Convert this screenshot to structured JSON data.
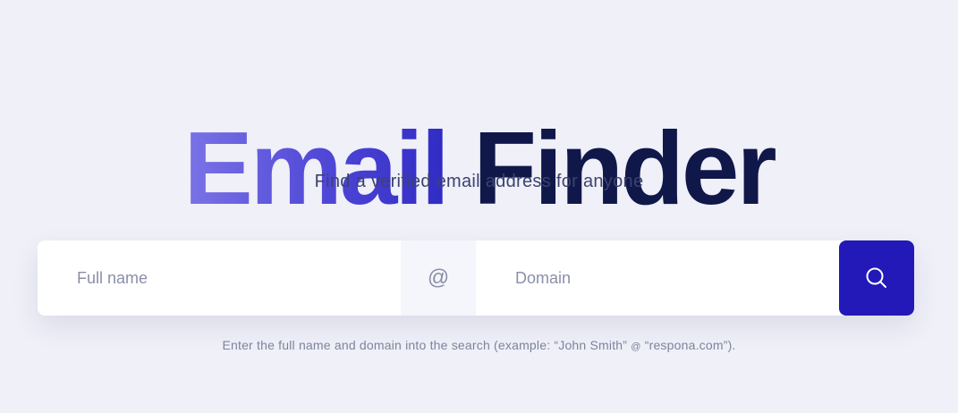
{
  "hero": {
    "title_accent": "Email",
    "title_main": "Finder",
    "subtitle": "Find a verified email address for anyone"
  },
  "search": {
    "name_placeholder": "Full name",
    "name_value": "",
    "at_symbol": "@",
    "domain_placeholder": "Domain",
    "domain_value": "",
    "button_icon": "search-icon"
  },
  "hint": {
    "before": "Enter the full name and domain into the search (example: “John Smith”",
    "at": "@",
    "after": "“respona.com”)."
  },
  "colors": {
    "background": "#eff0f8",
    "title_main": "#10184a",
    "accent_gradient_start": "#7b74e6",
    "accent_gradient_end": "#2f2bc4",
    "button": "#2219b8"
  }
}
